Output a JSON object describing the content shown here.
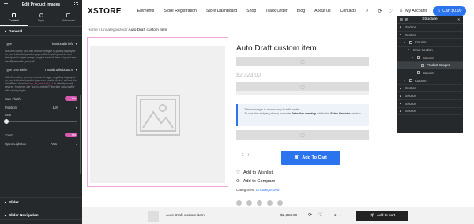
{
  "editor": {
    "title": "Edit Product Images",
    "tabs": [
      {
        "label": "Content"
      },
      {
        "label": "Style"
      },
      {
        "label": "Advanced"
      }
    ],
    "general_label": "General",
    "type_label": "Type",
    "type_value": "Thumbnails left",
    "help_1": "With this option, you can choose the type of gallery displayed on your individual product pages. Each gallery has its own beauty and unique design, so give each of them a try and see the difference for yourself",
    "mobile_label": "Type on mobile",
    "mobile_value": "Thumbnails bottom",
    "help_2a": "With this option, you can choose the type of gallery displayed on your individual product pages on mobile device. will use the WordPress function",
    "help_2_code": "\"wp_is_mobile()\"",
    "help_2b": "to identify mobile devices. However, the \"wp_is_mobile()\" function may conflict with cache plugins.",
    "sale_flash_label": "Sale Flash",
    "sale_flash_value": "Yes",
    "position_label": "Position",
    "position_value": "Left",
    "axis_label": "Axis",
    "axis_level": 0,
    "zoom_label": "Zoom",
    "zoom_value": "Yes",
    "lightbox_label": "Open Lightbox",
    "lightbox_value": "Yes",
    "slider_label": "Slider",
    "slider_nav_label": "Slider Navigation"
  },
  "header": {
    "logo": "XSTORE",
    "nav": [
      "Elements",
      "Store Registration",
      "Store Dashboard",
      "Shop",
      "Track Order",
      "Blog",
      "About us",
      "Contacts"
    ],
    "account": "My Account",
    "cart": "Cart $0.00"
  },
  "breadcrumb": {
    "home": "Home",
    "sep": "/",
    "cat": "Uncategorized",
    "current": "Auto Draft custom item"
  },
  "product": {
    "title": "Auto Draft custom item",
    "price": "$2,323.00",
    "notice_prefix": "This message is shown only in edit mode.",
    "notice_mid": "To use this widget, please, activate",
    "notice_bold_1": "Fake live viewing",
    "notice_within": "within the",
    "notice_bold_2": "Sales Booster",
    "notice_suffix": "section.",
    "qty": "1",
    "qty_minus": "−",
    "qty_plus": "+",
    "add_to_cart": "Add To Cart",
    "wishlist": "Add to Wishlist",
    "compare": "Add to Compare",
    "categories_label": "Categories:",
    "categories_value": "Uncategorized"
  },
  "sticky": {
    "name": "Auto Draft custom item",
    "price": "$2,323.00",
    "qty": "1",
    "button": "Add to cart"
  },
  "structure": {
    "title": "Structure",
    "items": [
      {
        "label": "Section",
        "level": 0,
        "expanded": false,
        "type": "section"
      },
      {
        "label": "Section",
        "level": 0,
        "expanded": true,
        "type": "section"
      },
      {
        "label": "Column",
        "level": 1,
        "expanded": true,
        "type": "column"
      },
      {
        "label": "Inner Section",
        "level": 2,
        "expanded": true,
        "type": "section"
      },
      {
        "label": "Column",
        "level": 3,
        "expanded": true,
        "type": "column"
      },
      {
        "label": "Product Images",
        "level": 4,
        "expanded": null,
        "type": "widget",
        "selected": true
      },
      {
        "label": "Column",
        "level": 3,
        "expanded": false,
        "type": "column"
      },
      {
        "label": "Column",
        "level": 1,
        "expanded": false,
        "type": "column"
      },
      {
        "label": "Section",
        "level": 0,
        "expanded": false,
        "type": "section"
      },
      {
        "label": "Section",
        "level": 0,
        "expanded": false,
        "type": "section"
      },
      {
        "label": "Section",
        "level": 0,
        "expanded": false,
        "type": "section"
      },
      {
        "label": "Section",
        "level": 0,
        "expanded": false,
        "type": "section"
      }
    ],
    "footer": "···"
  },
  "colors": {
    "accent": "#2b74ed",
    "toggle": "#d65bb0",
    "panel": "#26292c",
    "gallery_border": "#f2a6dd"
  }
}
